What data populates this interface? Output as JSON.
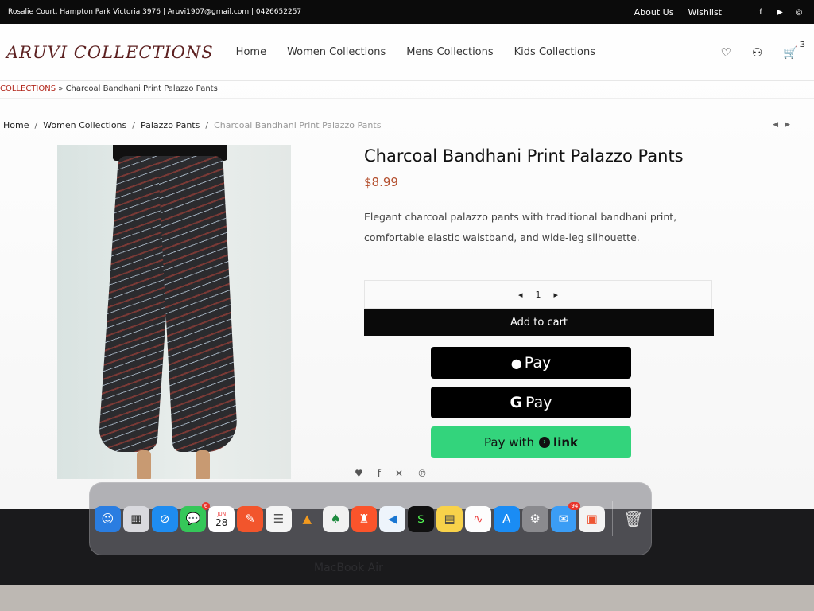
{
  "topbar": {
    "contact": "Rosalie Court, Hampton Park Victoria 3976 | Aruvi1907@gmail.com | 0426652257",
    "about": "About Us",
    "wishlist": "Wishlist",
    "social": [
      "facebook-icon",
      "youtube-icon",
      "instagram-icon"
    ]
  },
  "header": {
    "logo": "ARUVI COLLECTIONS",
    "nav": [
      "Home",
      "Women Collections",
      "Mens Collections",
      "Kids Collections"
    ],
    "cart_count": "3"
  },
  "subcrumb": {
    "collections": "COLLECTIONS",
    "sep": "»",
    "page": "Charcoal Bandhani Print Palazzo Pants"
  },
  "breadcrumb": {
    "items": [
      "Home",
      "Women Collections",
      "Palazzo Pants"
    ],
    "current": "Charcoal Bandhani Print Palazzo Pants",
    "sep": "/"
  },
  "product": {
    "title": "Charcoal Bandhani Print Palazzo Pants",
    "price": "$8.99",
    "description": "Elegant charcoal palazzo pants with traditional bandhani print, comfortable elastic waistband, and wide-leg silhouette.",
    "quantity": "1",
    "add_to_cart": "Add to cart",
    "apple_pay": "Pay",
    "google_pay": "Pay",
    "link_pay_prefix": "Pay with",
    "link_pay_word": "link"
  },
  "dock": {
    "messages_badge": "6",
    "calendar_month": "JUN",
    "calendar_day": "28",
    "mail_badge": "94",
    "macbook_label": "MacBook Air"
  },
  "colors": {
    "price": "#b4502f",
    "link_green": "#33d47c",
    "logo": "#5b1f1f"
  }
}
